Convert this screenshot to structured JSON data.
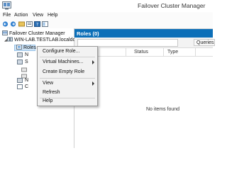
{
  "window": {
    "title": "Failover Cluster Manager"
  },
  "menubar": {
    "items": [
      "File",
      "Action",
      "View",
      "Help"
    ]
  },
  "toolbar": {
    "buttons": [
      "back-icon",
      "forward-icon",
      "up-icon",
      "properties-icon",
      "help-icon",
      "show-hide-icon"
    ]
  },
  "tree": {
    "root": "Failover Cluster Manager",
    "cluster": "WIN-LAB.TESTLAB.localdom",
    "roles": "Roles",
    "frag_n1": "N",
    "frag_s": "S",
    "frag_n2": "N",
    "frag_c": "C"
  },
  "right": {
    "title": "Roles (0)",
    "queries": "Queries",
    "columns": [
      "Status",
      "Type"
    ],
    "empty": "No items found"
  },
  "context_menu": {
    "items": [
      {
        "label": "Configure Role...",
        "submenu": false
      },
      {
        "label": "Virtual Machines...",
        "submenu": true
      },
      {
        "label": "Create Empty Role",
        "submenu": false
      },
      {
        "label": "View",
        "submenu": true
      },
      {
        "label": "Refresh",
        "submenu": false
      },
      {
        "label": "Help",
        "submenu": false
      }
    ]
  }
}
